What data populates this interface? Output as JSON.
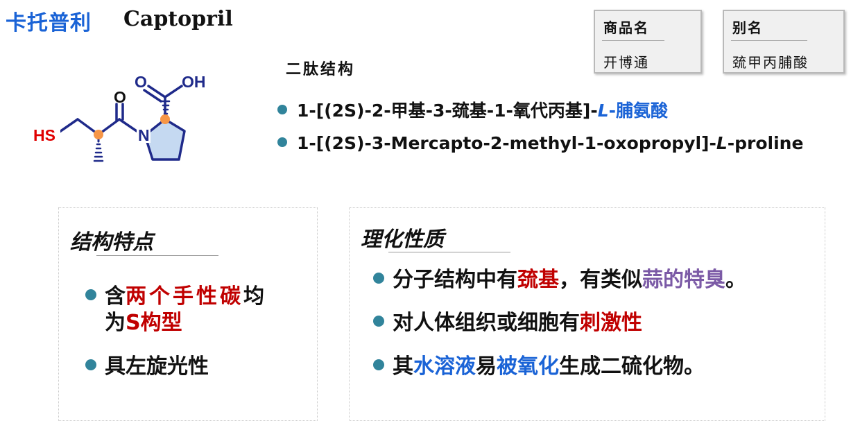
{
  "header": {
    "title_cn": "卡托普利",
    "title_en": "Captopril"
  },
  "trade_name": {
    "label": "商品名",
    "value": "开博通"
  },
  "alias": {
    "label": "别名",
    "value": "巯甲丙脯酸"
  },
  "structure": {
    "label": "二肽结构",
    "atoms": {
      "hs": "HS",
      "o": "O",
      "n": "N",
      "o2": "O",
      "oh": "OH"
    }
  },
  "iupac": {
    "cn_prefix": "1-[(2S)-2-甲基-3-巯基-1-氧代丙基]-",
    "cn_L": "L",
    "cn_suffix": "-脯氨酸",
    "en_prefix": "1-[(2S)-3-Mercapto-2-methyl-1-oxopropyl]-",
    "en_L": "L",
    "en_suffix": "-proline"
  },
  "struct_panel": {
    "title": "结构特点",
    "item1_a": "含",
    "item1_b": "两个手性碳",
    "item1_c": "均",
    "item1_d": "为",
    "item1_e": "S构型",
    "item2": "具左旋光性"
  },
  "phys_panel": {
    "title": "理化性质",
    "item1_a": "分子结构中有",
    "item1_b": "巯基",
    "item1_c": "，有类似",
    "item1_d": "蒜的特臭",
    "item1_e": "。",
    "item2_a": "对人体组织或细胞有",
    "item2_b": "刺激性",
    "item3_a": "其",
    "item3_b": "水溶液",
    "item3_c": "易",
    "item3_d": "被氧化",
    "item3_e": "生成二硫化物。"
  },
  "colors": {
    "title_blue": "#1a63d6",
    "emphasis_red": "#c00000",
    "emphasis_purple": "#7b5aa6",
    "bullet_teal": "#31849b",
    "molecule_navy": "#1f2a8a",
    "ring_fill": "#c5d9f1",
    "chiral_orange": "#f79646"
  }
}
